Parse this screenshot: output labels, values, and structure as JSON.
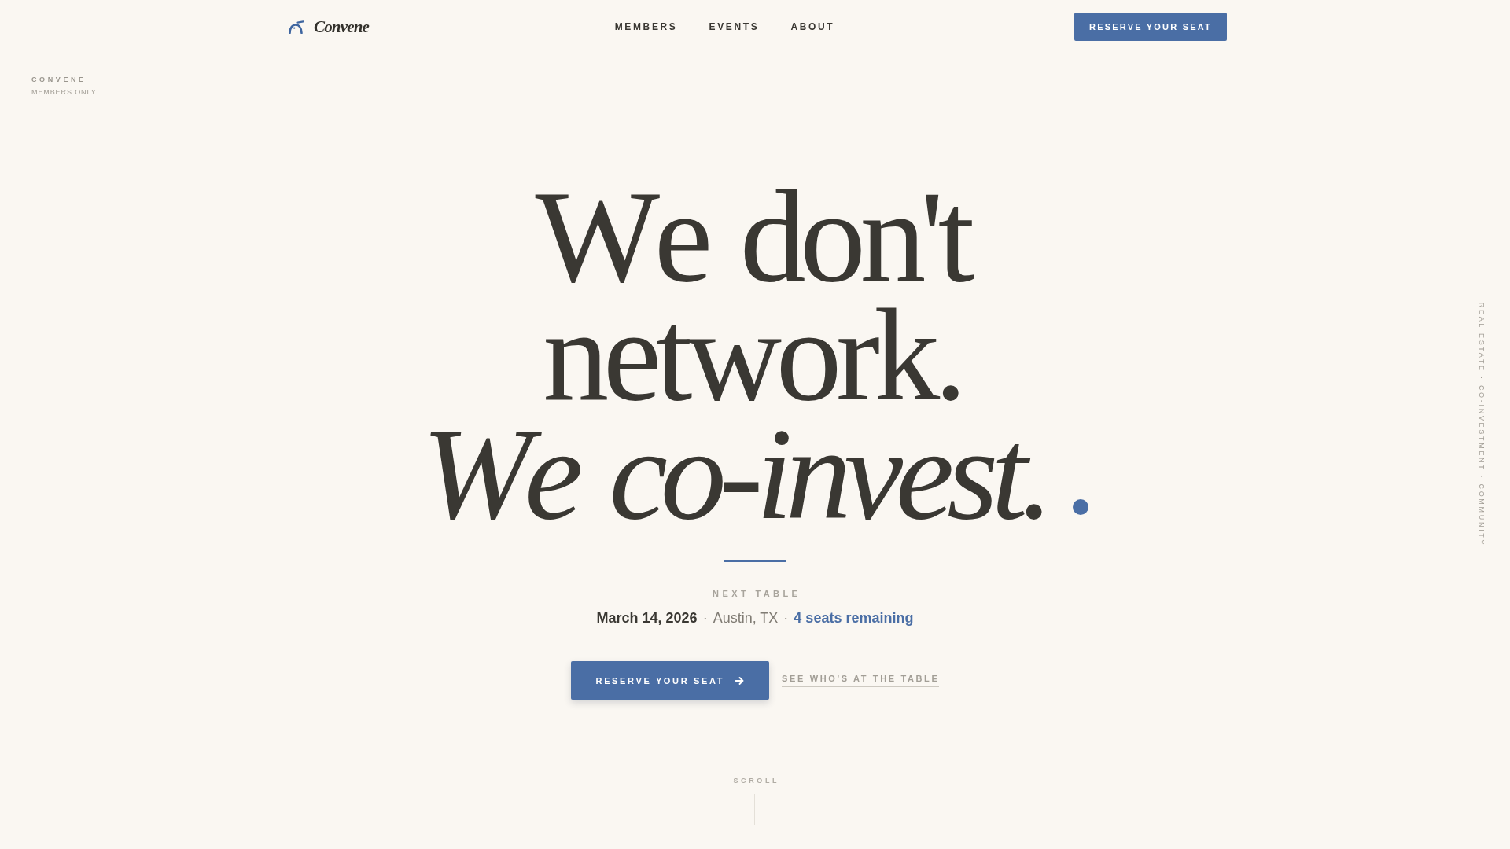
{
  "nav": {
    "logo": "Convene",
    "links": [
      {
        "label": "MEMBERS"
      },
      {
        "label": "EVENTS"
      },
      {
        "label": "ABOUT"
      }
    ],
    "cta": "RESERVE YOUR SEAT"
  },
  "corner_label": {
    "title": "CONVENE",
    "subtitle": "MEMBERS ONLY"
  },
  "side_label": "REAL ESTATE · CO-INVESTMENT · COMMUNITY",
  "hero": {
    "headline": [
      {
        "text": "We don't",
        "italic": false
      },
      {
        "text": "network.",
        "italic": false
      },
      {
        "text": "We co-invest.",
        "italic": true
      }
    ],
    "next_table": {
      "label": "NEXT TABLE",
      "details": [
        {
          "kind": "date",
          "text": "March 14, 2026"
        },
        {
          "kind": "separator",
          "text": "·"
        },
        {
          "kind": "location",
          "text": "Austin, TX"
        },
        {
          "kind": "separator",
          "text": "·"
        },
        {
          "kind": "seats",
          "text": "4 seats remaining"
        }
      ]
    },
    "primary_button": "RESERVE YOUR SEAT",
    "secondary_link": "SEE WHO'S AT THE TABLE",
    "scroll_hint": "SCROLL"
  }
}
